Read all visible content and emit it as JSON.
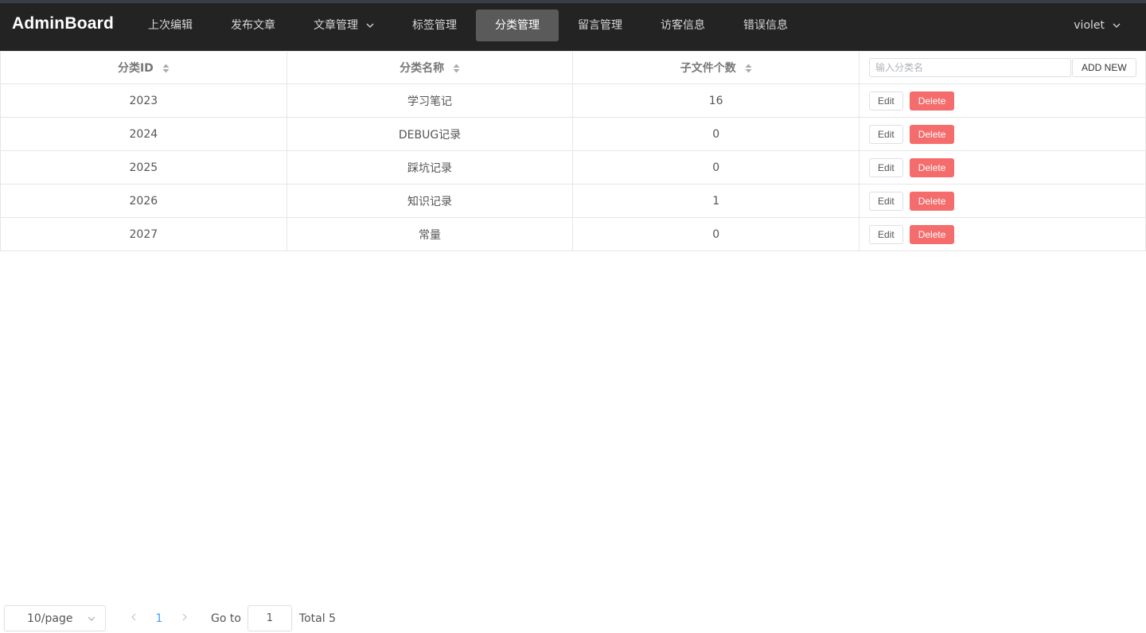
{
  "app": {
    "brand": "AdminBoard"
  },
  "nav": {
    "items": [
      {
        "label": "上次编辑",
        "active": false
      },
      {
        "label": "发布文章",
        "active": false
      },
      {
        "label": "文章管理",
        "active": false
      },
      {
        "label": "标签管理",
        "active": false
      },
      {
        "label": "分类管理",
        "active": true
      },
      {
        "label": "留言管理",
        "active": false
      },
      {
        "label": "访客信息",
        "active": false
      },
      {
        "label": "错误信息",
        "active": false
      }
    ],
    "user": "violet"
  },
  "table": {
    "headers": {
      "id": "分类ID",
      "name": "分类名称",
      "count": "子文件个数"
    },
    "search_placeholder": "输入分类名",
    "search_value": "",
    "add_label": "ADD NEW",
    "edit_label": "Edit",
    "delete_label": "Delete",
    "rows": [
      {
        "id": "2023",
        "name": "学习笔记",
        "count": "16"
      },
      {
        "id": "2024",
        "name": "DEBUG记录",
        "count": "0"
      },
      {
        "id": "2025",
        "name": "踩坑记录",
        "count": "0"
      },
      {
        "id": "2026",
        "name": "知识记录",
        "count": "1"
      },
      {
        "id": "2027",
        "name": "常量",
        "count": "0"
      }
    ]
  },
  "pagination": {
    "page_size": "10/page",
    "current_page": "1",
    "goto_label": "Go to",
    "goto_value": "1",
    "total": "Total 5"
  },
  "colors": {
    "topbar": "#232323",
    "active_nav": "#5a5a5a",
    "danger": "#f56c6c",
    "link": "#409eff"
  },
  "icons": {
    "dropdown": "chevron-down-icon",
    "sort": "sort-caret-icon",
    "prev": "chevron-left-icon",
    "next": "chevron-right-icon"
  }
}
